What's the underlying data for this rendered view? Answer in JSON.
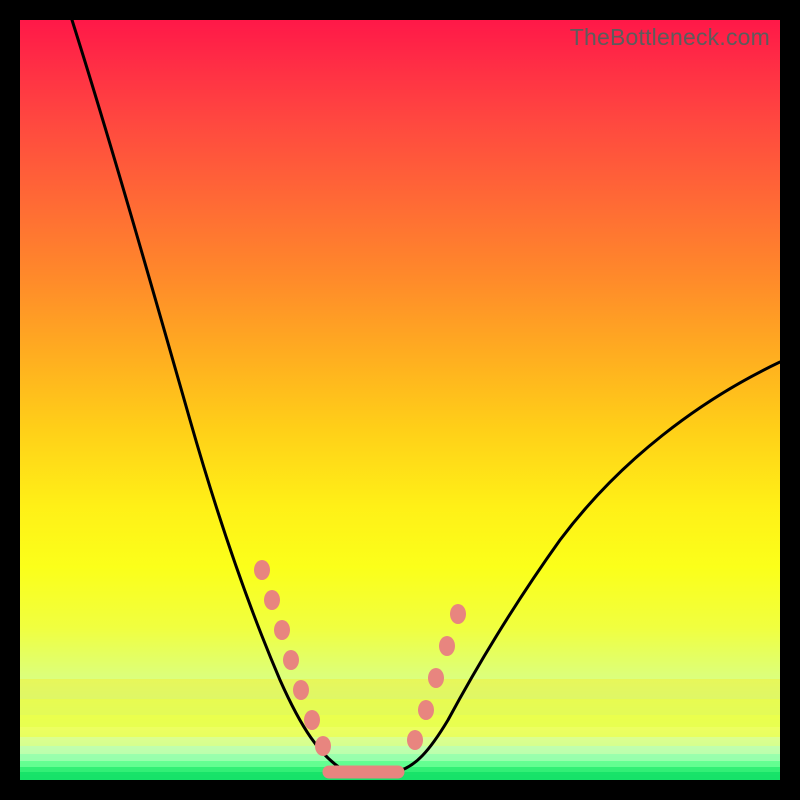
{
  "watermark": "TheBottleneck.com",
  "chart_data": {
    "type": "line",
    "title": "",
    "xlabel": "",
    "ylabel": "",
    "x_range_fraction": [
      0,
      1
    ],
    "y_range_percent": [
      0,
      100
    ],
    "description": "Bottleneck percentage vs. hardware parameter. Minimum (no bottleneck) near x≈0.43; bottleneck rises steeply toward 100% at x≈0.07 and toward ~50% at x≈1.0. Background gradient encodes bottleneck severity (green low, red high).",
    "series": [
      {
        "name": "bottleneck-curve",
        "x": [
          0.07,
          0.12,
          0.16,
          0.2,
          0.24,
          0.28,
          0.31,
          0.34,
          0.36,
          0.385,
          0.405,
          0.43,
          0.47,
          0.49,
          0.51,
          0.535,
          0.56,
          0.6,
          0.65,
          0.72,
          0.8,
          0.9,
          1.0
        ],
        "y": [
          100,
          88,
          78,
          68,
          58,
          46,
          36,
          26,
          18,
          10,
          6,
          0,
          0,
          2,
          6,
          12,
          18,
          24,
          30,
          36,
          42,
          47,
          51
        ]
      }
    ],
    "markers": {
      "name": "highlight-dots",
      "color": "#e8857f",
      "points": [
        {
          "x": 0.317,
          "y": 28
        },
        {
          "x": 0.33,
          "y": 24
        },
        {
          "x": 0.345,
          "y": 20
        },
        {
          "x": 0.355,
          "y": 16
        },
        {
          "x": 0.37,
          "y": 12
        },
        {
          "x": 0.385,
          "y": 8
        },
        {
          "x": 0.4,
          "y": 5
        },
        {
          "x": 0.52,
          "y": 8
        },
        {
          "x": 0.535,
          "y": 13
        },
        {
          "x": 0.545,
          "y": 18
        },
        {
          "x": 0.56,
          "y": 22
        },
        {
          "x": 0.575,
          "y": 25
        }
      ]
    },
    "trough_segment": {
      "name": "flat-minimum",
      "color": "#e8857f",
      "x0": 0.405,
      "x1": 0.495,
      "y": 1
    },
    "gradient_stops": [
      {
        "pos": 0.0,
        "color": "#ff1848"
      },
      {
        "pos": 0.5,
        "color": "#ffd018"
      },
      {
        "pos": 0.8,
        "color": "#f0ff40"
      },
      {
        "pos": 1.0,
        "color": "#17e86a"
      }
    ]
  }
}
